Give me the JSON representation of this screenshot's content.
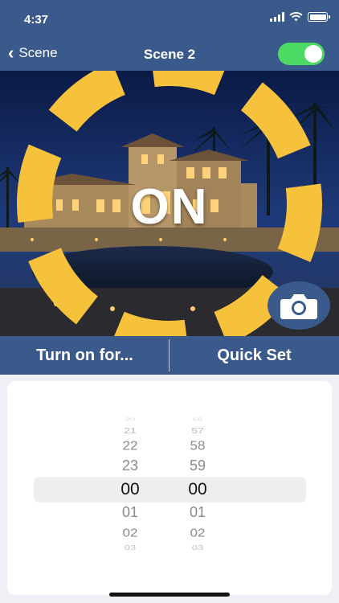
{
  "status_bar": {
    "time": "4:37",
    "icons": [
      "signal-icon",
      "wifi-icon",
      "battery-icon"
    ]
  },
  "nav": {
    "back_label": "Scene",
    "title": "Scene 2",
    "toggle_on": true
  },
  "hero": {
    "state_label": "ON",
    "ring_color": "#f7c23b",
    "camera_icon": "camera-icon"
  },
  "actions": {
    "turn_on_for": "Turn on for...",
    "quick_set": "Quick Set"
  },
  "picker": {
    "hours": [
      "20",
      "21",
      "22",
      "23",
      "00",
      "01",
      "02",
      "03"
    ],
    "minutes": [
      "56",
      "57",
      "58",
      "59",
      "00",
      "01",
      "02",
      "03"
    ],
    "selected_hour": "00",
    "selected_minute": "00"
  },
  "colors": {
    "nav_blue": "#3a5a8c",
    "toggle_green": "#4cd964",
    "accent_yellow": "#f7c23b"
  }
}
